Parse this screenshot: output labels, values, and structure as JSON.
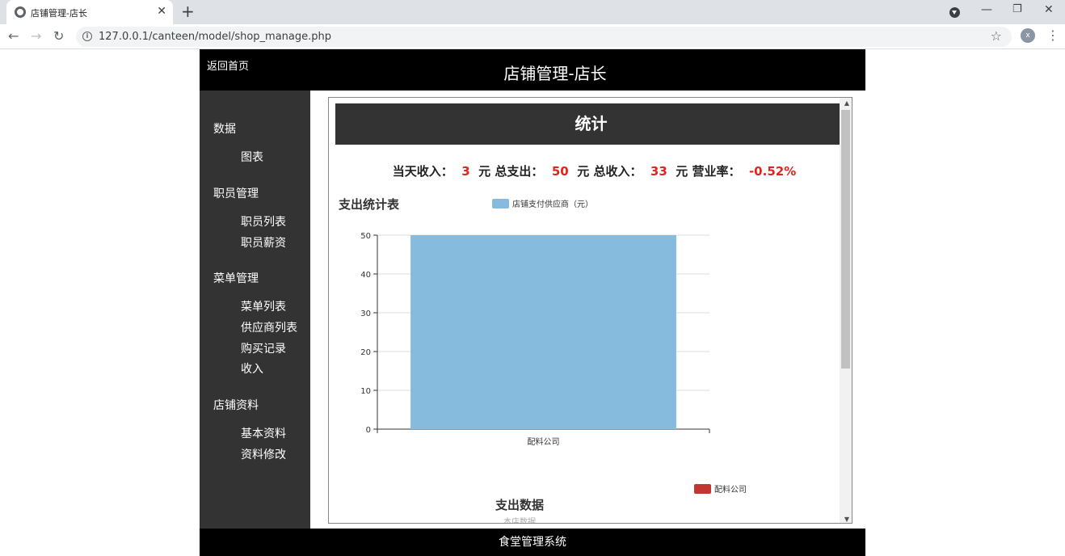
{
  "browser": {
    "tab_title": "店铺管理-店长",
    "url": "127.0.0.1/canteen/model/shop_manage.php",
    "avatar_letter": "x"
  },
  "header": {
    "back_label": "返回首页",
    "title": "店铺管理-店长"
  },
  "sidebar": {
    "sections": [
      {
        "label": "数据",
        "items": [
          "图表"
        ]
      },
      {
        "label": "职员管理",
        "items": [
          "职员列表",
          "职员薪资"
        ]
      },
      {
        "label": "菜单管理",
        "items": [
          "菜单列表",
          "供应商列表",
          "购买记录",
          "收入"
        ]
      },
      {
        "label": "店铺资料",
        "items": [
          "基本资料",
          "资料修改"
        ]
      }
    ]
  },
  "stats": {
    "heading": "统计",
    "label_today_income": "当天收入：",
    "today_income": "3",
    "unit1": "元",
    "label_total_expense": "总支出：",
    "total_expense": "50",
    "unit2": "元",
    "label_total_income": "总收入：",
    "total_income": "33",
    "unit3": "元",
    "label_rate": "营业率：",
    "rate": "-0.52%"
  },
  "chart_data": [
    {
      "type": "bar",
      "title": "支出统计表",
      "categories": [
        "配料公司"
      ],
      "series": [
        {
          "name": "店铺支付供应商（元）",
          "values": [
            50
          ],
          "color": "#87bbde"
        }
      ],
      "ylim": [
        0,
        50
      ],
      "yticks": [
        0,
        10,
        20,
        30,
        40,
        50
      ],
      "grid": true,
      "legend": "top"
    },
    {
      "type": "pie",
      "title": "支出数据",
      "subtitle": "本店数据",
      "categories": [
        "配料公司"
      ],
      "legend_entries": [
        {
          "name": "配料公司",
          "color": "#c23531"
        }
      ]
    }
  ],
  "footer": {
    "text": "食堂管理系统"
  },
  "colors": {
    "accent_red": "#e1251b",
    "sidebar_bg": "#333333",
    "header_bg": "#000000"
  }
}
